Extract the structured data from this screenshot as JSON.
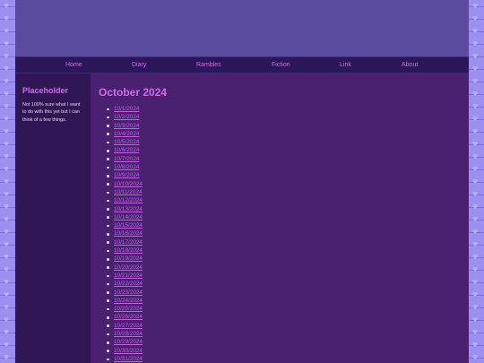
{
  "nav": {
    "items": [
      "Home",
      "Diary",
      "Rambles",
      "Fiction",
      "Link",
      "About"
    ]
  },
  "sidebar": {
    "title": "Placeholder",
    "text": "Not 100% sure what I want to do with this yet but I can think of a few things."
  },
  "content": {
    "title": "October 2024",
    "dates": [
      "10/1/2024",
      "10/2/2024",
      "10/3/2024",
      "10/4/2024",
      "10/5/2024",
      "10/6/2024",
      "10/7/2024",
      "10/8/2024",
      "10/9/2024",
      "10/10/2024",
      "10/11/2024",
      "10/12/2024",
      "10/13/2024",
      "10/14/2024",
      "10/15/2024",
      "10/16/2024",
      "10/17/2024",
      "10/18/2024",
      "10/19/2024",
      "10/20/2024",
      "10/21/2024",
      "10/22/2024",
      "10/23/2024",
      "10/24/2024",
      "10/25/2024",
      "10/26/2024",
      "10/27/2024",
      "10/28/2024",
      "10/29/2024",
      "10/30/2024",
      "10/31/2024"
    ]
  },
  "colors": {
    "accent": "#d16be8",
    "page_bg": "#4a2170",
    "sidebar_bg": "#301654",
    "nav_bg": "#2a1658",
    "banner_bg": "#5b4b9f",
    "outer_bg": "#9c8ff2"
  },
  "icons": {
    "side_pattern": "heart-icon"
  }
}
